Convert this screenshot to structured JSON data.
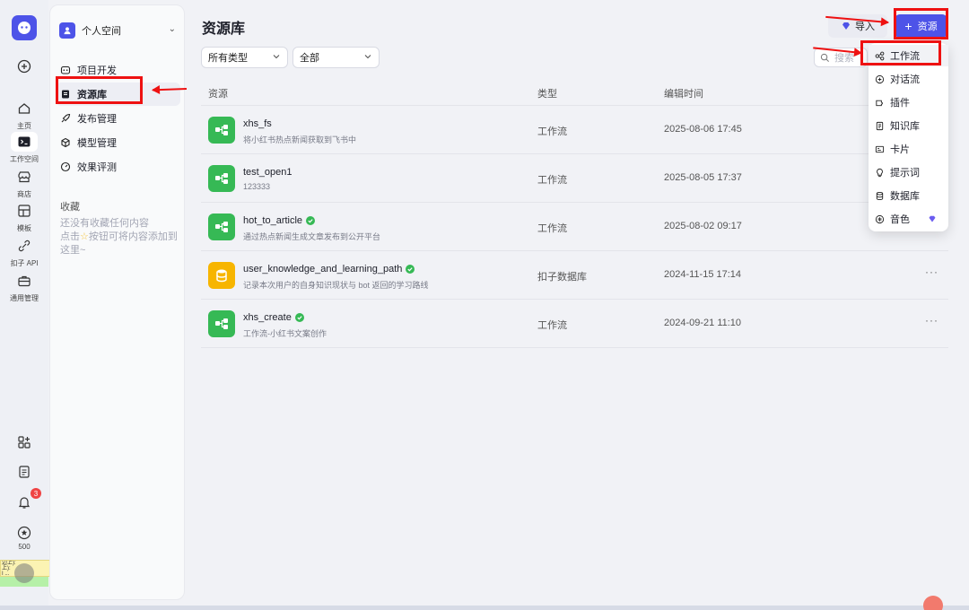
{
  "rail": {
    "items": [
      {
        "label": "主页",
        "icon": "home-icon"
      },
      {
        "label": "工作空间",
        "icon": "terminal-icon"
      },
      {
        "label": "商店",
        "icon": "store-icon"
      },
      {
        "label": "模板",
        "icon": "layout-icon"
      },
      {
        "label": "扣子 API",
        "icon": "api-icon"
      },
      {
        "label": "通用管理",
        "icon": "briefcase-icon"
      }
    ],
    "notification_count": "3",
    "points": "500",
    "tooltip_lines": [
      "边上):",
      "上):",
      "I ..."
    ]
  },
  "sidebar": {
    "space_name": "个人空间",
    "nav": [
      {
        "label": "项目开发",
        "icon": "bot-icon"
      },
      {
        "label": "资源库",
        "icon": "library-icon"
      },
      {
        "label": "发布管理",
        "icon": "rocket-icon"
      },
      {
        "label": "模型管理",
        "icon": "cube-icon"
      },
      {
        "label": "效果评测",
        "icon": "gauge-icon"
      }
    ],
    "favorites_title": "收藏",
    "favorites_empty_line1": "还没有收藏任何内容",
    "favorites_empty_line2": "点击",
    "favorites_empty_line3": "按钮可将内容添加到这里~"
  },
  "main": {
    "title": "资源库",
    "import_label": "导入",
    "add_label": "资源",
    "filter_type": "所有类型",
    "filter_scope": "全部",
    "search_placeholder": "搜索",
    "columns": {
      "resource": "资源",
      "type": "类型",
      "edit_time": "编辑时间"
    },
    "rows": [
      {
        "name": "xhs_fs",
        "desc": "将小红书热点新闻获取到飞书中",
        "type": "工作流",
        "time": "2025-08-06 17:45",
        "verified": false,
        "icon": "workflow-icon",
        "color": "#36b955"
      },
      {
        "name": "test_open1",
        "desc": "123333",
        "type": "工作流",
        "time": "2025-08-05 17:37",
        "verified": false,
        "icon": "workflow-icon",
        "color": "#36b955"
      },
      {
        "name": "hot_to_article",
        "desc": "通过热点新闻生成文章发布到公开平台",
        "type": "工作流",
        "time": "2025-08-02 09:17",
        "verified": true,
        "icon": "workflow-icon",
        "color": "#36b955"
      },
      {
        "name": "user_knowledge_and_learning_path",
        "desc": "记录本次用户的自身知识现状与 bot 返回的学习路线",
        "type": "扣子数据库",
        "time": "2024-11-15 17:14",
        "verified": true,
        "icon": "database-icon",
        "color": "#f7b500"
      },
      {
        "name": "xhs_create",
        "desc": "工作流-小红书文案创作",
        "type": "工作流",
        "time": "2024-09-21 11:10",
        "verified": true,
        "icon": "workflow-icon",
        "color": "#36b955"
      }
    ],
    "more_label": "···"
  },
  "dropdown": {
    "items": [
      {
        "label": "工作流",
        "icon": "workflow-icon"
      },
      {
        "label": "对话流",
        "icon": "chatflow-icon"
      },
      {
        "label": "插件",
        "icon": "plugin-icon"
      },
      {
        "label": "知识库",
        "icon": "knowledge-icon"
      },
      {
        "label": "卡片",
        "icon": "card-icon"
      },
      {
        "label": "提示词",
        "icon": "prompt-icon"
      },
      {
        "label": "数据库",
        "icon": "database-icon"
      },
      {
        "label": "音色",
        "icon": "voice-icon"
      }
    ]
  },
  "colors": {
    "brand": "#4d53e8",
    "workflow": "#36b955",
    "database": "#f7b500",
    "annotation": "#ee1111"
  }
}
